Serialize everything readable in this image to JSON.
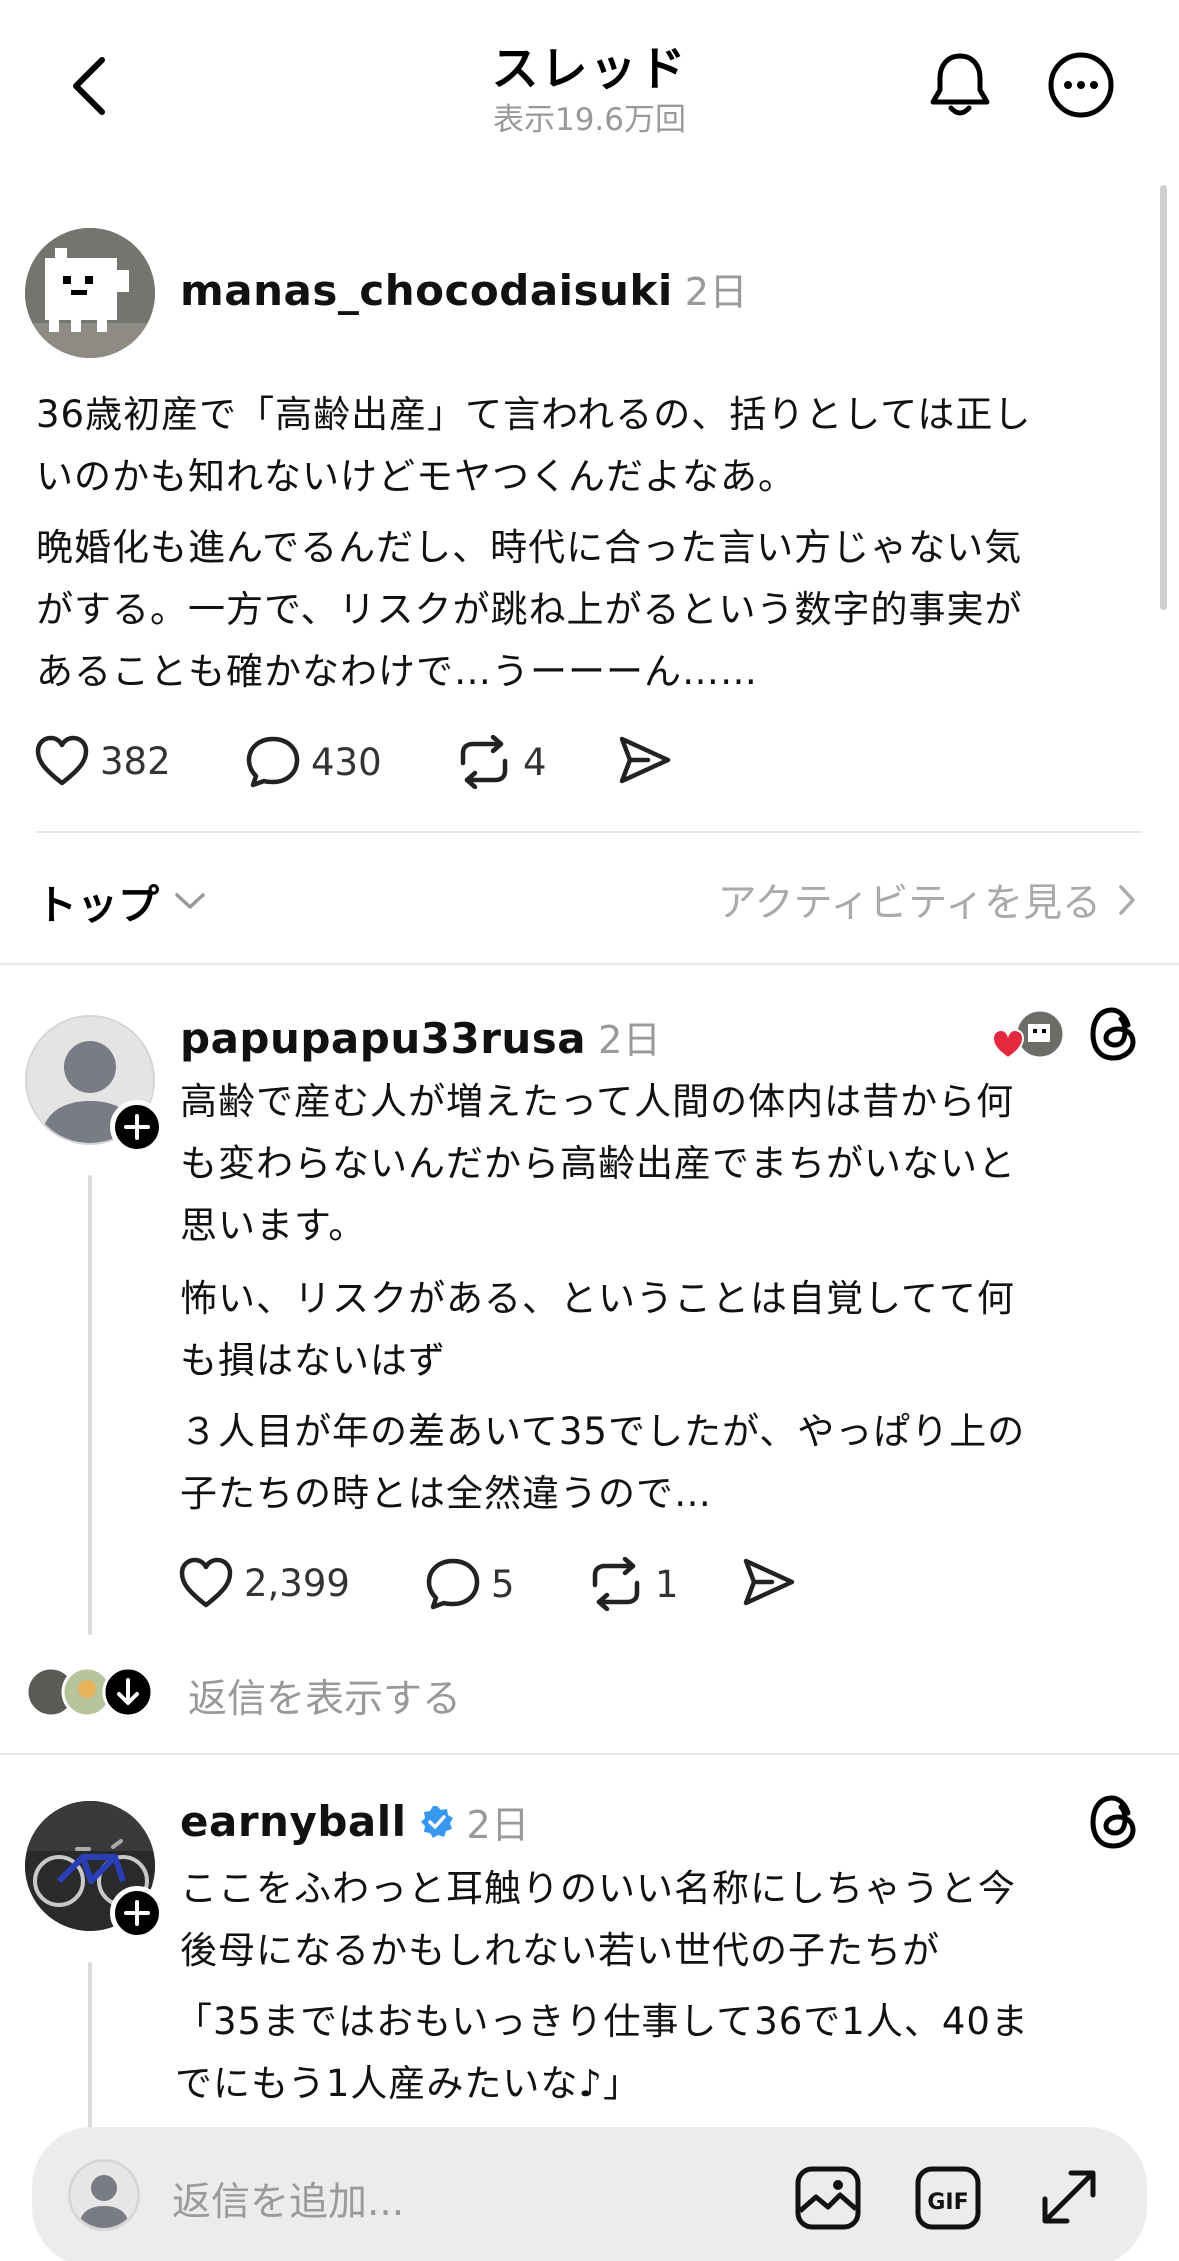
{
  "header": {
    "title": "スレッド",
    "views": "表示19.6万回"
  },
  "post": {
    "username": "manas_chocodaisuki",
    "time": "2日",
    "lines": [
      "36歳初産で「高齢出産」て言われるの、括りとしては正し",
      "いのかも知れないけどモヤつくんだよなあ。",
      "晩婚化も進んでるんだし、時代に合った言い方じゃない気",
      "がする。一方で、リスクが跳ね上がるという数字的事実が",
      "あることも確かなわけで…うーーーん……"
    ],
    "likes": "382",
    "comments": "430",
    "reposts": "4"
  },
  "sort": {
    "label": "トップ",
    "activity": "アクティビティを見る"
  },
  "replies": [
    {
      "username": "papupapu33rusa",
      "time": "2日",
      "lines": [
        "高齢で産む人が増えたって人間の体内は昔から何",
        "も変わらないんだから高齢出産でまちがいないと",
        "思います。",
        "怖い、リスクがある、ということは自覚してて何",
        "も損はないはず",
        "３人目が年の差あいて35でしたが、やっぱり上の",
        "子たちの時とは全然違うので…"
      ],
      "likes": "2,399",
      "comments": "5",
      "reposts": "1",
      "show_replies": "返信を表示する"
    },
    {
      "username": "earnyball",
      "time": "2日",
      "lines": [
        "ここをふわっと耳触りのいい名称にしちゃうと今",
        "後母になるかもしれない若い世代の子たちが",
        "「35まではおもいっきり仕事して36で1人、40ま",
        "でにもう1人産みたいな♪」"
      ]
    }
  ],
  "reply_bar": {
    "placeholder": "返信を追加..."
  },
  "colors": {
    "verified": "#3897f0",
    "heart": "#e6283c",
    "muted": "#999999"
  }
}
